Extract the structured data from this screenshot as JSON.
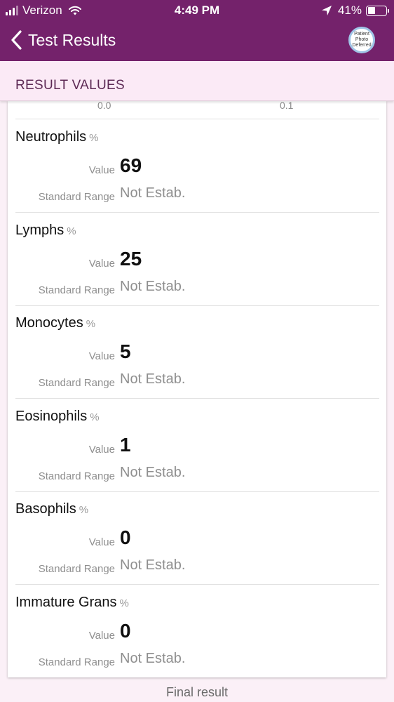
{
  "status_bar": {
    "carrier": "Verizon",
    "time": "4:49 PM",
    "battery": "41%",
    "battery_level": 0.41
  },
  "nav": {
    "back_label": "Test Results",
    "avatar_lines": [
      "Patient",
      "Photo",
      "Deferred"
    ]
  },
  "section": {
    "title": "RESULT VALUES"
  },
  "axis": {
    "ticks": [
      "0.0",
      "0.1"
    ]
  },
  "results": [
    {
      "name": "Neutrophils",
      "unit": "%",
      "value_label": "Value",
      "value": "69",
      "range_label": "Standard Range",
      "range": "Not Estab."
    },
    {
      "name": "Lymphs",
      "unit": "%",
      "value_label": "Value",
      "value": "25",
      "range_label": "Standard Range",
      "range": "Not Estab."
    },
    {
      "name": "Monocytes",
      "unit": "%",
      "value_label": "Value",
      "value": "5",
      "range_label": "Standard Range",
      "range": "Not Estab."
    },
    {
      "name": "Eosinophils",
      "unit": "%",
      "value_label": "Value",
      "value": "1",
      "range_label": "Standard Range",
      "range": "Not Estab."
    },
    {
      "name": "Basophils",
      "unit": "%",
      "value_label": "Value",
      "value": "0",
      "range_label": "Standard Range",
      "range": "Not Estab."
    },
    {
      "name": "Immature Grans",
      "unit": "%",
      "value_label": "Value",
      "value": "0",
      "range_label": "Standard Range",
      "range": "Not Estab."
    }
  ],
  "footer": {
    "text": "Final result"
  },
  "colors": {
    "brand": "#74226b",
    "header_bg": "#fbeaf6"
  }
}
